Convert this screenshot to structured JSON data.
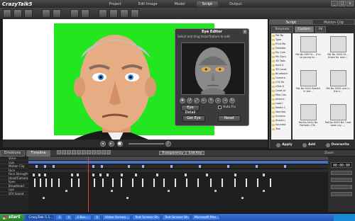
{
  "app": {
    "title": "CrazyTalk5"
  },
  "nav": {
    "items": [
      "Project",
      "Edit Image",
      "Model",
      "Script",
      "Output"
    ],
    "selected": "Script"
  },
  "window_buttons": [
    "_",
    "□",
    "x"
  ],
  "eye_editor": {
    "title": "Eye Editor",
    "description": "Select and drag facial feature to edit.",
    "buttons": {
      "eye_detail": "Eye Detail",
      "get_eye": "Get Eye",
      "reset": "Reset"
    },
    "checkbox_label": "Auto Fix",
    "close": "x"
  },
  "rpanel": {
    "tabs": [
      "Script",
      "Motion Clip"
    ],
    "subtabs": [
      "Template",
      "Custom",
      "All"
    ],
    "tree": [
      "Pat Bo",
      "Type",
      "Print Ma",
      "Desktop",
      "My Com",
      "My Docs",
      "3D Tabs",
      "Avrd A",
      "3D Locat",
      "Bluetooth",
      "Camera",
      "CSS Re",
      "cTalk S",
      "Great Ar",
      "Mea Cav",
      "Interne",
      "Load I",
      "Media C",
      "Voorliao",
      "Screens",
      "Shortcu",
      "Soundst",
      "Test"
    ],
    "thumbs": [
      {
        "cap": "Pat Bo 009 Fe... (I'm so young to..."
      },
      {
        "cap": "Pat Bo 0004 Fe... those for mon..."
      },
      {
        "cap": "Pat Bo 0041 Breath in the..."
      },
      {
        "cap": "Pat Bo 0042 and in the s..."
      },
      {
        "cap": "Pat Bo 0044 Bo Pathetic (TN.."
      },
      {
        "cap": "Pat Bo 0063 Be I had been my -..."
      }
    ],
    "footer": [
      "Apply",
      "Add",
      "Overwrite"
    ]
  },
  "timeline": {
    "tabs": [
      "Emotions",
      "Timeline"
    ],
    "buttons": [
      "Transparency",
      "Edit Key"
    ],
    "zoom_label": "Zoom",
    "counter": "00:00:00",
    "tracks": [
      "Voice",
      "Lips",
      "Motion Clip",
      "Face",
      "Face Strength",
      "Head/Camera",
      "Eyes",
      "Brow/Head",
      "Lips",
      "SFX Sound"
    ]
  },
  "taskbar": {
    "start": "start",
    "tasks": [
      "CrazyTalk 5.1...",
      "3",
      "3",
      "3 Bus...",
      "3",
      "Video Screen...",
      "Test Screen Sh...",
      "Test Screen Sh...",
      "Microsoft Pho..."
    ],
    "active_index": 0
  }
}
